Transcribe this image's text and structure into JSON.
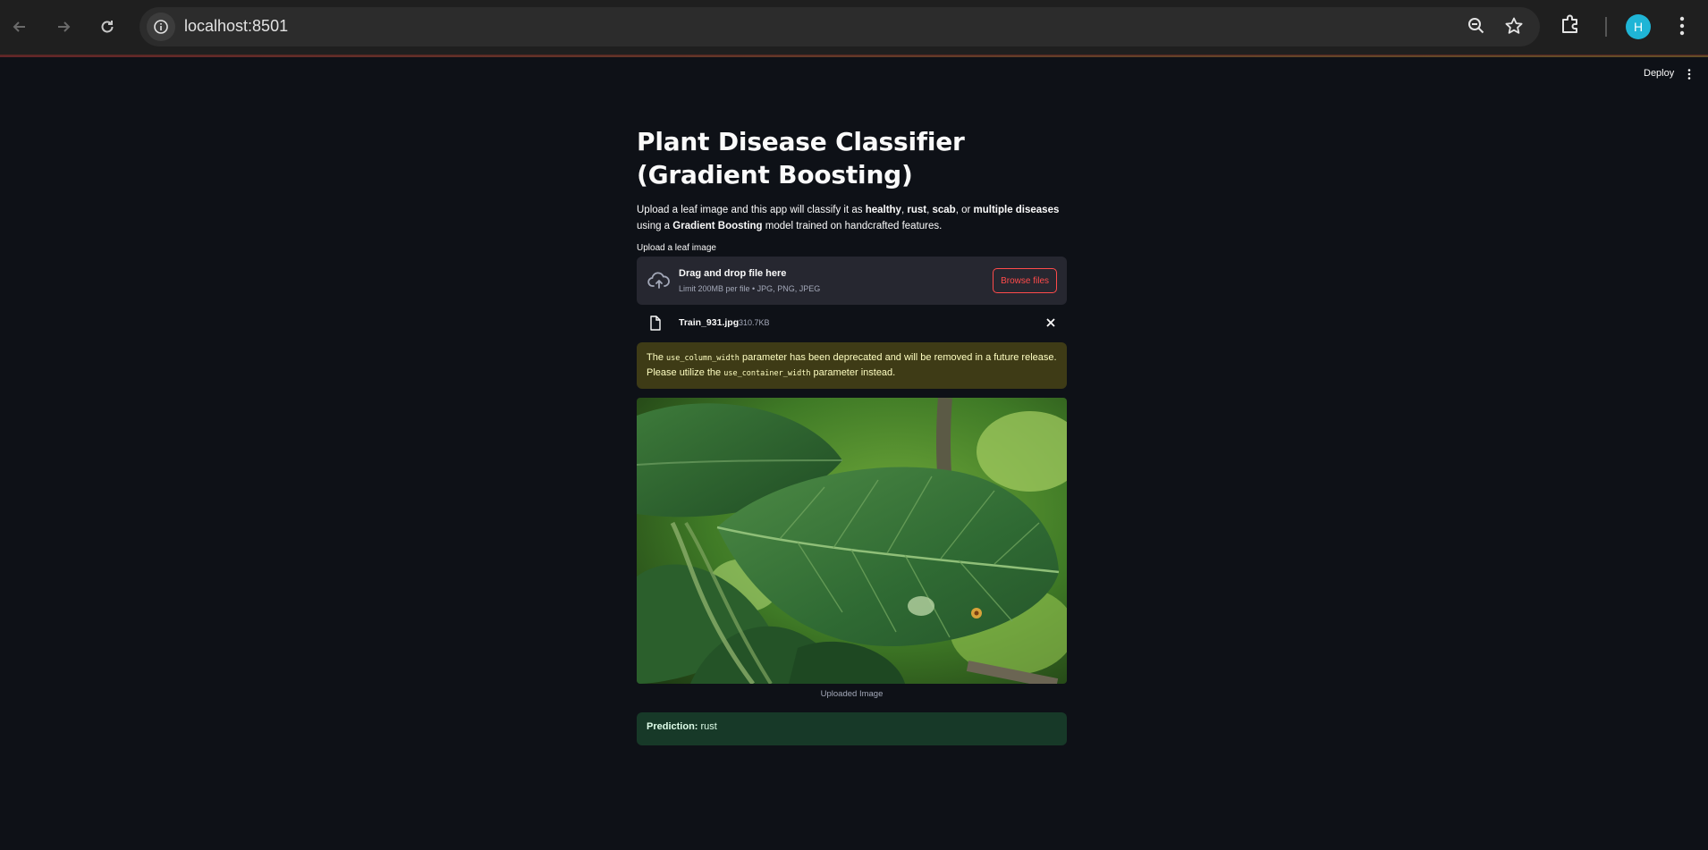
{
  "browser": {
    "url": "localhost:8501",
    "avatar_letter": "H"
  },
  "header": {
    "deploy_label": "Deploy"
  },
  "app": {
    "title": "Plant Disease Classifier (Gradient Boosting)",
    "desc": {
      "p1": "Upload a leaf image and this app will classify it as ",
      "healthy": "healthy",
      "c1": ", ",
      "rust": "rust",
      "c2": ", ",
      "scab": "scab",
      "c3": ", or ",
      "multiple": "multiple diseases",
      "p2": " using a ",
      "model": "Gradient Boosting",
      "p3": " model trained on handcrafted features."
    },
    "uploader": {
      "label": "Upload a leaf image",
      "drag_text": "Drag and drop file here",
      "limit_text": "Limit 200MB per file • JPG, PNG, JPEG",
      "browse_label": "Browse files",
      "file_name": "Train_931.jpg",
      "file_size": "310.7KB"
    },
    "warning": {
      "t1": "The ",
      "code1": "use_column_width",
      "t2": " parameter has been deprecated and will be removed in a future release. Please utilize the ",
      "code2": "use_container_width",
      "t3": " parameter instead."
    },
    "image_caption": "Uploaded Image",
    "prediction": {
      "label": "Prediction:",
      "value": "rust"
    }
  }
}
